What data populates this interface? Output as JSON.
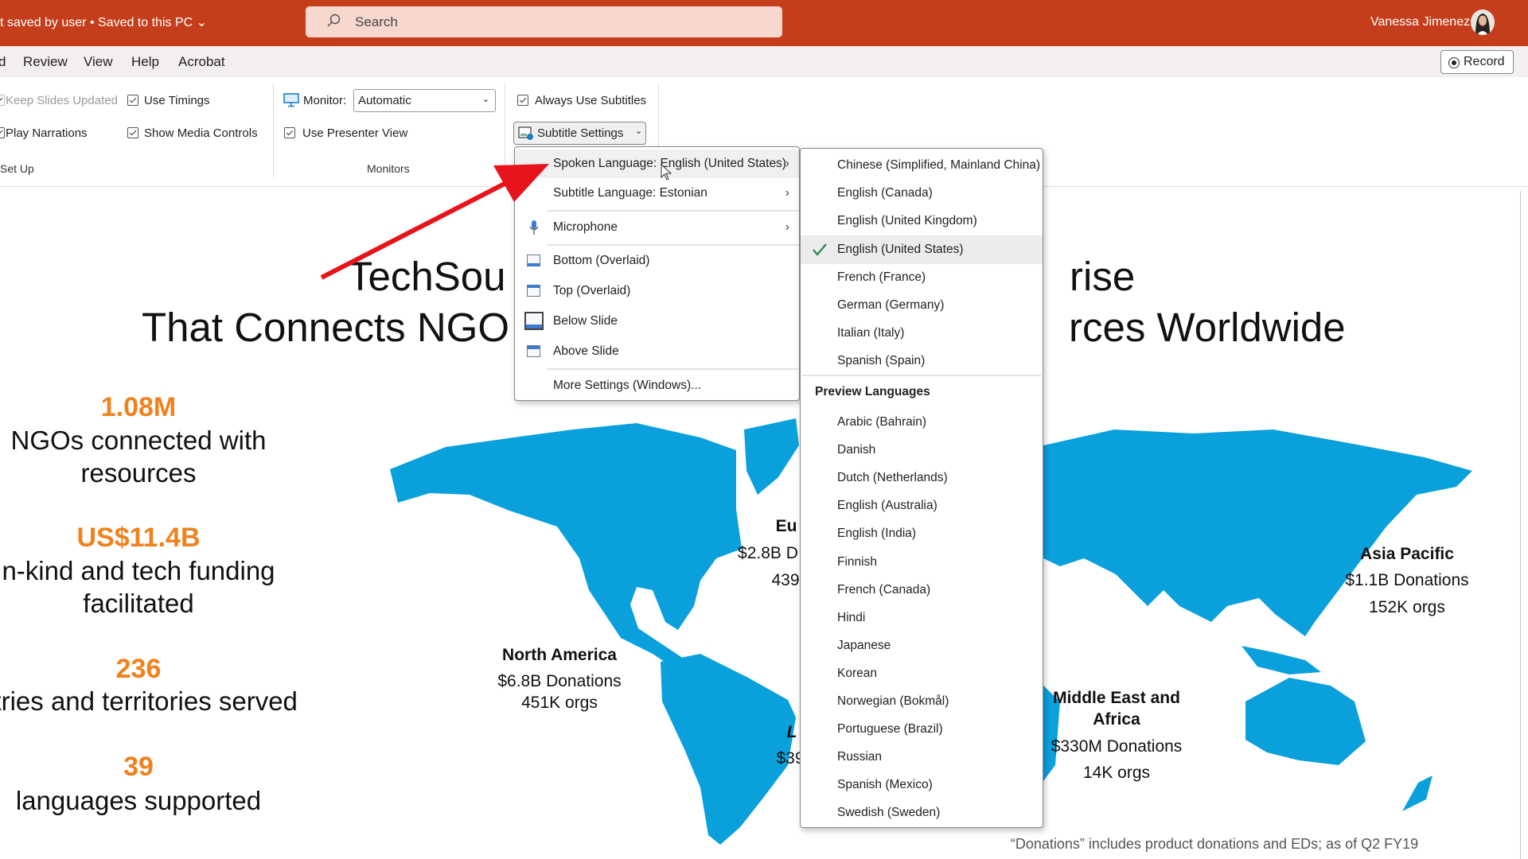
{
  "titlebar": {
    "doc_status": "t saved by user • Saved to this PC ⌄",
    "search_placeholder": "Search",
    "user_name": "Vanessa Jimenez"
  },
  "tabs": [
    {
      "label": "d"
    },
    {
      "label": "Review"
    },
    {
      "label": "View"
    },
    {
      "label": "Help"
    },
    {
      "label": "Acrobat"
    }
  ],
  "record_label": "Record",
  "ribbon": {
    "setup": {
      "keep_slides_updated": "Keep Slides Updated",
      "use_timings": "Use Timings",
      "play_narrations": "Play Narrations",
      "show_media_controls": "Show Media Controls",
      "group_label": "Set Up"
    },
    "monitors": {
      "monitor_label": "Monitor:",
      "monitor_value": "Automatic",
      "use_presenter_view": "Use Presenter View",
      "group_label": "Monitors"
    },
    "captions": {
      "always_use_subtitles": "Always Use Subtitles",
      "subtitle_settings": "Subtitle Settings"
    }
  },
  "subtitle_menu": {
    "spoken_language": "Spoken Language: English (United States)",
    "subtitle_language": "Subtitle Language: Estonian",
    "microphone": "Microphone",
    "bottom_overlaid": "Bottom (Overlaid)",
    "top_overlaid": "Top (Overlaid)",
    "below_slide": "Below Slide",
    "above_slide": "Above Slide",
    "more_settings": "More Settings (Windows)..."
  },
  "language_menu": {
    "languages": [
      "Chinese (Simplified, Mainland China)",
      "English (Canada)",
      "English (United Kingdom)",
      "English (United States)",
      "French (France)",
      "German (Germany)",
      "Italian (Italy)",
      "Spanish (Spain)"
    ],
    "selected": "English (United States)",
    "preview_header": "Preview Languages",
    "preview_languages": [
      "Arabic (Bahrain)",
      "Danish",
      "Dutch (Netherlands)",
      "English (Australia)",
      "English (India)",
      "Finnish",
      "French (Canada)",
      "Hindi",
      "Japanese",
      "Korean",
      "Norwegian (Bokmål)",
      "Portuguese (Brazil)",
      "Russian",
      "Spanish (Mexico)",
      "Swedish (Sweden)"
    ]
  },
  "slide": {
    "title_fragments": [
      "TechSou",
      "rise",
      "That Connects NGO",
      "rces Worldwide"
    ],
    "stats": [
      {
        "value": "1.08M",
        "lines": [
          "NGOs connected with",
          "resources"
        ]
      },
      {
        "value": "US$11.4B",
        "lines": [
          "n-kind and tech funding",
          "facilitated"
        ]
      },
      {
        "value": "236",
        "lines": [
          "ntries and territories served"
        ]
      },
      {
        "value": "39",
        "lines": [
          "languages supported"
        ]
      }
    ],
    "regions": {
      "north_america": {
        "name": "North America",
        "donations": "$6.8B Donations",
        "orgs": "451K orgs"
      },
      "europe_partial": {
        "name": "Eu",
        "donations": "$2.8B D",
        "orgs": "439"
      },
      "latam_partial": {
        "name": "L",
        "donations": "$39"
      },
      "asia_pacific": {
        "name": "Asia Pacific",
        "donations": "$1.1B Donations",
        "orgs": "152K orgs"
      },
      "mea": {
        "name_line1": "Middle East and",
        "name_line2": "Africa",
        "donations": "$330M Donations",
        "orgs": "14K orgs"
      }
    },
    "footnote": "“Donations” includes product donations and EDs; as of Q2 FY19"
  },
  "colors": {
    "titlebar": "#c43e1c",
    "stat_orange": "#f0821e",
    "map_blue": "#0aa0dc",
    "arrow_red": "#e8141c",
    "check_green": "#2e8b57"
  }
}
